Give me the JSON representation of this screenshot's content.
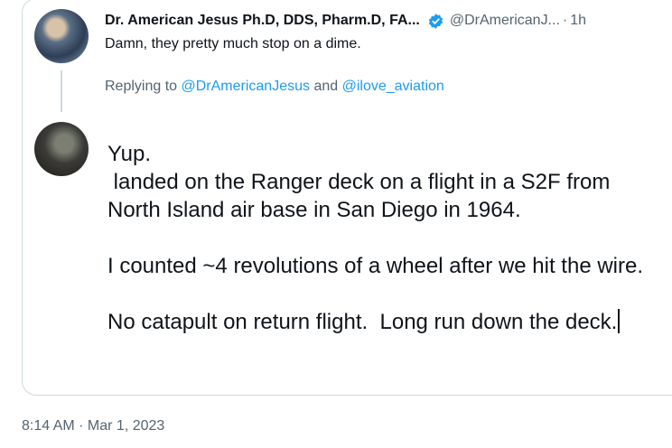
{
  "quoted_tweet": {
    "display_name": "Dr. American Jesus Ph.D, DDS, Pharm.D, FA...",
    "handle": "@DrAmericanJ...",
    "separator": "·",
    "time_ago": "1h",
    "text": "Damn, they pretty much stop on a dime."
  },
  "reply_context": {
    "prefix": "Replying to",
    "mention_1": "@DrAmericanJesus",
    "conjunction": "and",
    "mention_2": "@ilove_aviation"
  },
  "composer": {
    "line_1": "Yup.",
    "line_2": " landed on the Ranger deck on a flight in a S2F from North Island air base in San Diego in 1964.",
    "line_3": "I counted ~4 revolutions of a wheel after we hit the wire.",
    "line_4": "No catapult on return flight.  Long run down the deck."
  },
  "footer": {
    "timestamp": "8:14 AM · Mar 1, 2023"
  },
  "colors": {
    "link": "#1d9bf0",
    "secondary_text": "#536471",
    "border": "#cfd9de",
    "verified": "#1d9bf0"
  }
}
